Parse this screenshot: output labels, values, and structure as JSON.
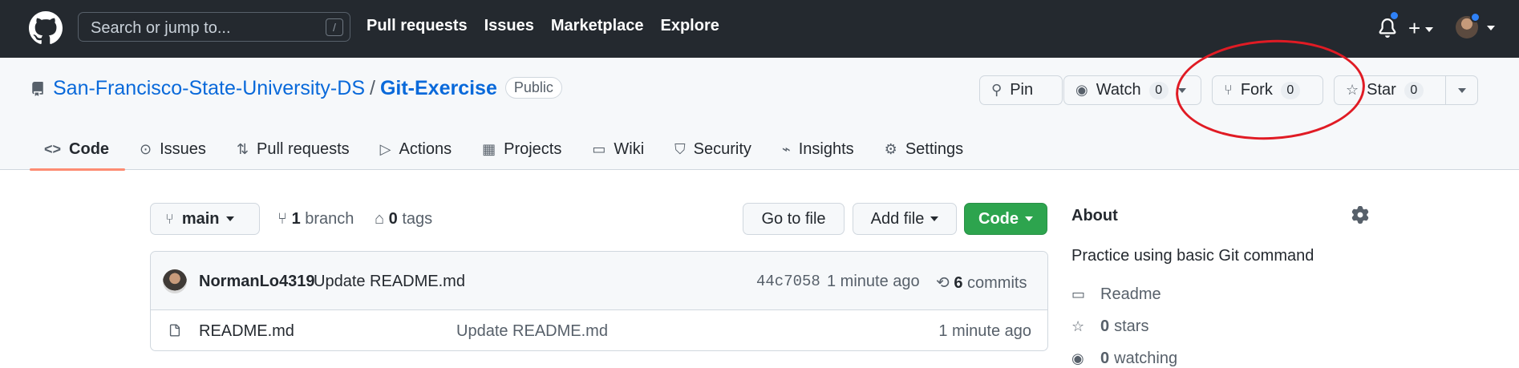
{
  "header": {
    "search_placeholder": "Search or jump to...",
    "search_shortcut": "/",
    "nav": [
      "Pull requests",
      "Issues",
      "Marketplace",
      "Explore"
    ],
    "plus_label": "+"
  },
  "repo": {
    "owner": "San-Francisco-State-University-DS",
    "separator": "/",
    "name": "Git-Exercise",
    "visibility": "Public",
    "actions": {
      "pin_label": "Pin",
      "watch_label": "Watch",
      "watch_count": "0",
      "fork_label": "Fork",
      "fork_count": "0",
      "star_label": "Star",
      "star_count": "0"
    },
    "tabs": [
      {
        "label": "Code",
        "icon": "code-icon"
      },
      {
        "label": "Issues",
        "icon": "issue-icon"
      },
      {
        "label": "Pull requests",
        "icon": "pull-request-icon"
      },
      {
        "label": "Actions",
        "icon": "play-icon"
      },
      {
        "label": "Projects",
        "icon": "table-icon"
      },
      {
        "label": "Wiki",
        "icon": "book-icon"
      },
      {
        "label": "Security",
        "icon": "shield-icon"
      },
      {
        "label": "Insights",
        "icon": "graph-icon"
      },
      {
        "label": "Settings",
        "icon": "gear-icon"
      }
    ]
  },
  "toolbar": {
    "branch_button": "main",
    "branch_count": "1",
    "branch_word": "branch",
    "tag_count": "0",
    "tag_word": "tags",
    "go_to_file": "Go to file",
    "add_file": "Add file",
    "code": "Code"
  },
  "commit": {
    "author": "NormanLo4319",
    "message": "Update README.md",
    "sha": "44c7058",
    "time": "1 minute ago",
    "commits_count": "6",
    "commits_word": "commits"
  },
  "files": [
    {
      "name": "README.md",
      "message": "Update README.md",
      "time": "1 minute ago"
    }
  ],
  "about": {
    "title": "About",
    "description": "Practice using basic Git command",
    "readme": "Readme",
    "stars_count": "0",
    "stars_word": "stars",
    "watching_count": "0",
    "watching_word": "watching"
  },
  "colors": {
    "header_bg": "#24292f",
    "link": "#0969da",
    "code_button": "#2da44e",
    "active_tab_underline": "#fd8c73",
    "annotation": "#e01b24",
    "notification_dot": "#2f81f7"
  }
}
